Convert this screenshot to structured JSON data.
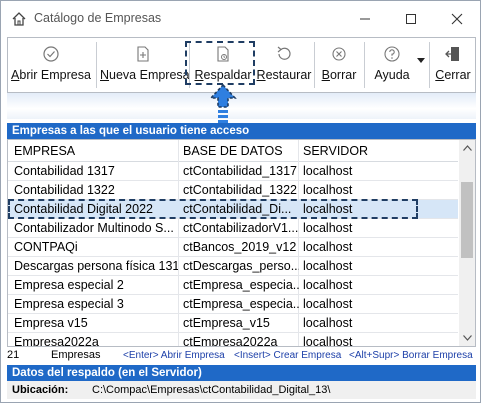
{
  "window": {
    "title": "Catálogo de Empresas",
    "icon": "home-icon"
  },
  "toolbar": {
    "buttons": [
      {
        "label_u": "A",
        "label_rest": "brir Empresa",
        "icon": "check-circle-icon"
      },
      {
        "label_u": "N",
        "label_rest": "ueva Empresa",
        "icon": "new-document-icon"
      },
      {
        "label_u": "R",
        "label_rest": "espaldar",
        "icon": "backup-document-icon"
      },
      {
        "label_u": "R",
        "label_rest": "estaurar",
        "icon": "restore-icon"
      },
      {
        "label_u": "B",
        "label_rest": "orrar",
        "icon": "delete-icon"
      },
      {
        "label_u": "",
        "label_rest": "Ayuda",
        "icon": "help-icon"
      },
      {
        "label_u": "C",
        "label_rest": "errar",
        "icon": "exit-icon"
      }
    ]
  },
  "companies": {
    "section_title": "Empresas a las que el usuario tiene acceso",
    "columns": [
      "EMPRESA",
      "BASE DE DATOS",
      "SERVIDOR"
    ],
    "rows": [
      [
        "Contabilidad 1317",
        "ctContabilidad_1317",
        "localhost"
      ],
      [
        "Contabilidad 1322",
        "ctContabilidad_1322",
        "localhost"
      ],
      [
        "Contabilidad Digital 2022",
        "ctContabilidad_Di...",
        "localhost"
      ],
      [
        "Contabilizador Multinodo S...",
        "ctContabilizadorV1...",
        "localhost"
      ],
      [
        "CONTPAQi",
        "ctBancos_2019_v12",
        "localhost"
      ],
      [
        "Descargas persona física 1311",
        "ctDescargas_perso...",
        "localhost"
      ],
      [
        "Empresa especial 2",
        "ctEmpresa_especia...",
        "localhost"
      ],
      [
        "Empresa especial 3",
        "ctEmpresa_especia...",
        "localhost"
      ],
      [
        "Empresa v15",
        "ctEmpresa_v15",
        "localhost"
      ],
      [
        "Empresa2022a",
        "ctEmpresa2022a",
        "localhost"
      ]
    ],
    "selected_row": 2
  },
  "status": {
    "count": "21",
    "count_label": "Empresas",
    "hint_open": "<Enter> Abrir Empresa",
    "hint_create": "<Insert> Crear Empresa",
    "hint_delete": "<Alt+Supr> Borrar Empresa"
  },
  "backup": {
    "section_title": "Datos del respaldo (en el Servidor)",
    "location_label": "Ubicación:",
    "location_value": "C:\\Compac\\Empresas\\ctContabilidad_Digital_13\\"
  },
  "colors": {
    "accent": "#1f69c7",
    "selected_row": "#d6e6f7",
    "callout": "#1f3d63",
    "arrow": "#2f7fe0"
  }
}
